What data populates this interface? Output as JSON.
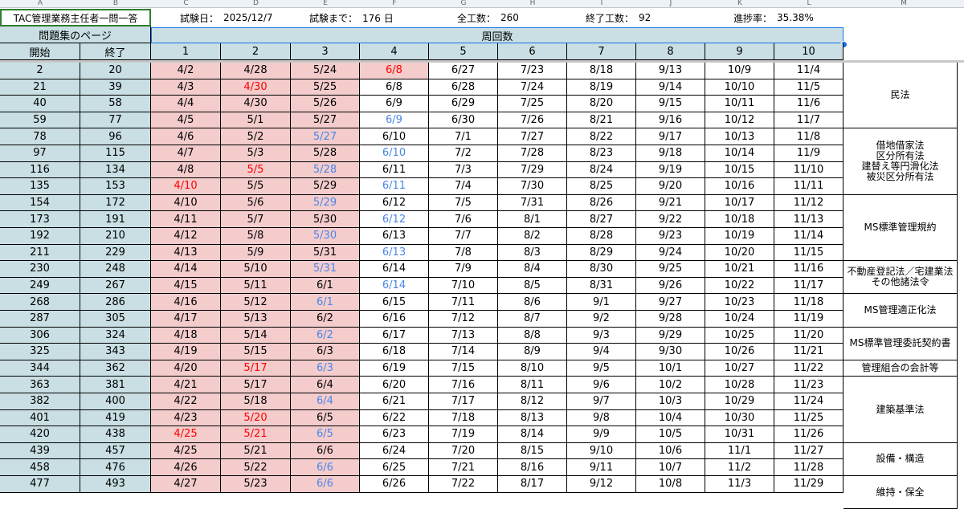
{
  "col_letters": [
    "A",
    "B",
    "C",
    "D",
    "E",
    "F",
    "G",
    "H",
    "I",
    "J",
    "K",
    "L",
    "M"
  ],
  "title": "TAC管理業務主任者一問一答",
  "info": {
    "exam_date_label": "試験日：",
    "exam_date_value": "2025/12/7",
    "until_label": "試験まで：",
    "until_value": "176 日",
    "total_label": "全工数：",
    "total_value": "260",
    "done_label": "終了工数：",
    "done_value": "92",
    "progress_label": "進捗率：",
    "progress_value": "35.38%"
  },
  "page_header": "問題集のページ",
  "rounds_header": "周回数",
  "start_label": "開始",
  "end_label": "終了",
  "round_numbers": [
    "1",
    "2",
    "3",
    "4",
    "5",
    "6",
    "7",
    "8",
    "9",
    "10"
  ],
  "colors": {
    "red": "#ff0000",
    "blue": "#4a86e8",
    "pink": "#f4cccc",
    "header": "#c9dfe3"
  },
  "rows": [
    {
      "start": "2",
      "end": "20",
      "dates": [
        "4/2",
        "4/28",
        "5/24",
        "6/8",
        "6/27",
        "7/23",
        "8/18",
        "9/13",
        "10/9",
        "11/4"
      ],
      "pink": 4,
      "color": [
        "",
        "",
        "",
        "r",
        "",
        "",
        "",
        "",
        "",
        ""
      ]
    },
    {
      "start": "21",
      "end": "39",
      "dates": [
        "4/3",
        "4/30",
        "5/25",
        "6/8",
        "6/28",
        "7/24",
        "8/19",
        "9/14",
        "10/10",
        "11/5"
      ],
      "pink": 3,
      "color": [
        "",
        "r",
        "",
        "",
        "",
        "",
        "",
        "",
        "",
        ""
      ]
    },
    {
      "start": "40",
      "end": "58",
      "dates": [
        "4/4",
        "4/30",
        "5/26",
        "6/9",
        "6/29",
        "7/25",
        "8/20",
        "9/15",
        "10/11",
        "11/6"
      ],
      "pink": 3,
      "color": [
        "",
        "",
        "",
        "",
        "",
        "",
        "",
        "",
        "",
        ""
      ]
    },
    {
      "start": "59",
      "end": "77",
      "dates": [
        "4/5",
        "5/1",
        "5/27",
        "6/9",
        "6/30",
        "7/26",
        "8/21",
        "9/16",
        "10/12",
        "11/7"
      ],
      "pink": 3,
      "color": [
        "",
        "",
        "",
        "b",
        "",
        "",
        "",
        "",
        "",
        ""
      ]
    },
    {
      "start": "78",
      "end": "96",
      "dates": [
        "4/6",
        "5/2",
        "5/27",
        "6/10",
        "7/1",
        "7/27",
        "8/22",
        "9/17",
        "10/13",
        "11/8"
      ],
      "pink": 3,
      "color": [
        "",
        "",
        "b",
        "",
        "",
        "",
        "",
        "",
        "",
        ""
      ]
    },
    {
      "start": "97",
      "end": "115",
      "dates": [
        "4/7",
        "5/3",
        "5/28",
        "6/10",
        "7/2",
        "7/28",
        "8/23",
        "9/18",
        "10/14",
        "11/9"
      ],
      "pink": 3,
      "color": [
        "",
        "",
        "",
        "b",
        "",
        "",
        "",
        "",
        "",
        ""
      ]
    },
    {
      "start": "116",
      "end": "134",
      "dates": [
        "4/8",
        "5/5",
        "5/28",
        "6/11",
        "7/3",
        "7/29",
        "8/24",
        "9/19",
        "10/15",
        "11/10"
      ],
      "pink": 3,
      "color": [
        "",
        "r",
        "b",
        "",
        "",
        "",
        "",
        "",
        "",
        ""
      ]
    },
    {
      "start": "135",
      "end": "153",
      "dates": [
        "4/10",
        "5/5",
        "5/29",
        "6/11",
        "7/4",
        "7/30",
        "8/25",
        "9/20",
        "10/16",
        "11/11"
      ],
      "pink": 3,
      "color": [
        "r",
        "",
        "",
        "b",
        "",
        "",
        "",
        "",
        "",
        ""
      ]
    },
    {
      "start": "154",
      "end": "172",
      "dates": [
        "4/10",
        "5/6",
        "5/29",
        "6/12",
        "7/5",
        "7/31",
        "8/26",
        "9/21",
        "10/17",
        "11/12"
      ],
      "pink": 3,
      "color": [
        "",
        "",
        "b",
        "",
        "",
        "",
        "",
        "",
        "",
        ""
      ]
    },
    {
      "start": "173",
      "end": "191",
      "dates": [
        "4/11",
        "5/7",
        "5/30",
        "6/12",
        "7/6",
        "8/1",
        "8/27",
        "9/22",
        "10/18",
        "11/13"
      ],
      "pink": 3,
      "color": [
        "",
        "",
        "",
        "b",
        "",
        "",
        "",
        "",
        "",
        ""
      ]
    },
    {
      "start": "192",
      "end": "210",
      "dates": [
        "4/12",
        "5/8",
        "5/30",
        "6/13",
        "7/7",
        "8/2",
        "8/28",
        "9/23",
        "10/19",
        "11/14"
      ],
      "pink": 3,
      "color": [
        "",
        "",
        "b",
        "",
        "",
        "",
        "",
        "",
        "",
        ""
      ]
    },
    {
      "start": "211",
      "end": "229",
      "dates": [
        "4/13",
        "5/9",
        "5/31",
        "6/13",
        "7/8",
        "8/3",
        "8/29",
        "9/24",
        "10/20",
        "11/15"
      ],
      "pink": 3,
      "color": [
        "",
        "",
        "",
        "b",
        "",
        "",
        "",
        "",
        "",
        ""
      ]
    },
    {
      "start": "230",
      "end": "248",
      "dates": [
        "4/14",
        "5/10",
        "5/31",
        "6/14",
        "7/9",
        "8/4",
        "8/30",
        "9/25",
        "10/21",
        "11/16"
      ],
      "pink": 3,
      "color": [
        "",
        "",
        "b",
        "",
        "",
        "",
        "",
        "",
        "",
        ""
      ]
    },
    {
      "start": "249",
      "end": "267",
      "dates": [
        "4/15",
        "5/11",
        "6/1",
        "6/14",
        "7/10",
        "8/5",
        "8/31",
        "9/26",
        "10/22",
        "11/17"
      ],
      "pink": 3,
      "color": [
        "",
        "",
        "",
        "b",
        "",
        "",
        "",
        "",
        "",
        ""
      ]
    },
    {
      "start": "268",
      "end": "286",
      "dates": [
        "4/16",
        "5/12",
        "6/1",
        "6/15",
        "7/11",
        "8/6",
        "9/1",
        "9/27",
        "10/23",
        "11/18"
      ],
      "pink": 3,
      "color": [
        "",
        "",
        "b",
        "",
        "",
        "",
        "",
        "",
        "",
        ""
      ]
    },
    {
      "start": "287",
      "end": "305",
      "dates": [
        "4/17",
        "5/13",
        "6/2",
        "6/16",
        "7/12",
        "8/7",
        "9/2",
        "9/28",
        "10/24",
        "11/19"
      ],
      "pink": 3,
      "color": [
        "",
        "",
        "",
        "",
        "",
        "",
        "",
        "",
        "",
        ""
      ]
    },
    {
      "start": "306",
      "end": "324",
      "dates": [
        "4/18",
        "5/14",
        "6/2",
        "6/17",
        "7/13",
        "8/8",
        "9/3",
        "9/29",
        "10/25",
        "11/20"
      ],
      "pink": 3,
      "color": [
        "",
        "",
        "b",
        "",
        "",
        "",
        "",
        "",
        "",
        ""
      ]
    },
    {
      "start": "325",
      "end": "343",
      "dates": [
        "4/19",
        "5/15",
        "6/3",
        "6/18",
        "7/14",
        "8/9",
        "9/4",
        "9/30",
        "10/26",
        "11/21"
      ],
      "pink": 3,
      "color": [
        "",
        "",
        "",
        "",
        "",
        "",
        "",
        "",
        "",
        ""
      ]
    },
    {
      "start": "344",
      "end": "362",
      "dates": [
        "4/20",
        "5/17",
        "6/3",
        "6/19",
        "7/15",
        "8/10",
        "9/5",
        "10/1",
        "10/27",
        "11/22"
      ],
      "pink": 3,
      "color": [
        "",
        "r",
        "b",
        "",
        "",
        "",
        "",
        "",
        "",
        ""
      ]
    },
    {
      "start": "363",
      "end": "381",
      "dates": [
        "4/21",
        "5/17",
        "6/4",
        "6/20",
        "7/16",
        "8/11",
        "9/6",
        "10/2",
        "10/28",
        "11/23"
      ],
      "pink": 3,
      "color": [
        "",
        "",
        "",
        "",
        "",
        "",
        "",
        "",
        "",
        ""
      ]
    },
    {
      "start": "382",
      "end": "400",
      "dates": [
        "4/22",
        "5/18",
        "6/4",
        "6/21",
        "7/17",
        "8/12",
        "9/7",
        "10/3",
        "10/29",
        "11/24"
      ],
      "pink": 3,
      "color": [
        "",
        "",
        "b",
        "",
        "",
        "",
        "",
        "",
        "",
        ""
      ]
    },
    {
      "start": "401",
      "end": "419",
      "dates": [
        "4/23",
        "5/20",
        "6/5",
        "6/22",
        "7/18",
        "8/13",
        "9/8",
        "10/4",
        "10/30",
        "11/25"
      ],
      "pink": 3,
      "color": [
        "",
        "r",
        "",
        "",
        "",
        "",
        "",
        "",
        "",
        ""
      ]
    },
    {
      "start": "420",
      "end": "438",
      "dates": [
        "4/25",
        "5/21",
        "6/5",
        "6/23",
        "7/19",
        "8/14",
        "9/9",
        "10/5",
        "10/31",
        "11/26"
      ],
      "pink": 3,
      "color": [
        "r",
        "r",
        "b",
        "",
        "",
        "",
        "",
        "",
        "",
        ""
      ]
    },
    {
      "start": "439",
      "end": "457",
      "dates": [
        "4/25",
        "5/21",
        "6/6",
        "6/24",
        "7/20",
        "8/15",
        "9/10",
        "10/6",
        "11/1",
        "11/27"
      ],
      "pink": 3,
      "color": [
        "",
        "",
        "",
        "",
        "",
        "",
        "",
        "",
        "",
        ""
      ]
    },
    {
      "start": "458",
      "end": "476",
      "dates": [
        "4/26",
        "5/22",
        "6/6",
        "6/25",
        "7/21",
        "8/16",
        "9/11",
        "10/7",
        "11/2",
        "11/28"
      ],
      "pink": 3,
      "color": [
        "",
        "",
        "b",
        "",
        "",
        "",
        "",
        "",
        "",
        ""
      ]
    },
    {
      "start": "477",
      "end": "493",
      "dates": [
        "4/27",
        "5/23",
        "6/6",
        "6/26",
        "7/22",
        "8/17",
        "9/12",
        "10/8",
        "11/3",
        "11/29"
      ],
      "pink": 3,
      "color": [
        "",
        "",
        "b",
        "",
        "",
        "",
        "",
        "",
        "",
        ""
      ]
    }
  ],
  "subjects": [
    {
      "label": "民法",
      "row_start": 0,
      "span": 4
    },
    {
      "label": "借地借家法\n区分所有法\n建替え等円滑化法\n被災区分所有法",
      "row_start": 4,
      "span": 4
    },
    {
      "label": "MS標準管理規約",
      "row_start": 8,
      "span": 4
    },
    {
      "label": "不動産登記法／宅建業法\nその他諸法令",
      "row_start": 12,
      "span": 2
    },
    {
      "label": "MS管理適正化法",
      "row_start": 14,
      "span": 2
    },
    {
      "label": "MS標準管理委託契約書",
      "row_start": 16,
      "span": 2
    },
    {
      "label": "管理組合の会計等",
      "row_start": 18,
      "span": 1
    },
    {
      "label": "建築基準法",
      "row_start": 19,
      "span": 4
    },
    {
      "label": "設備・構造",
      "row_start": 23,
      "span": 2
    },
    {
      "label": "維持・保全",
      "row_start": 25,
      "span": 2
    }
  ]
}
